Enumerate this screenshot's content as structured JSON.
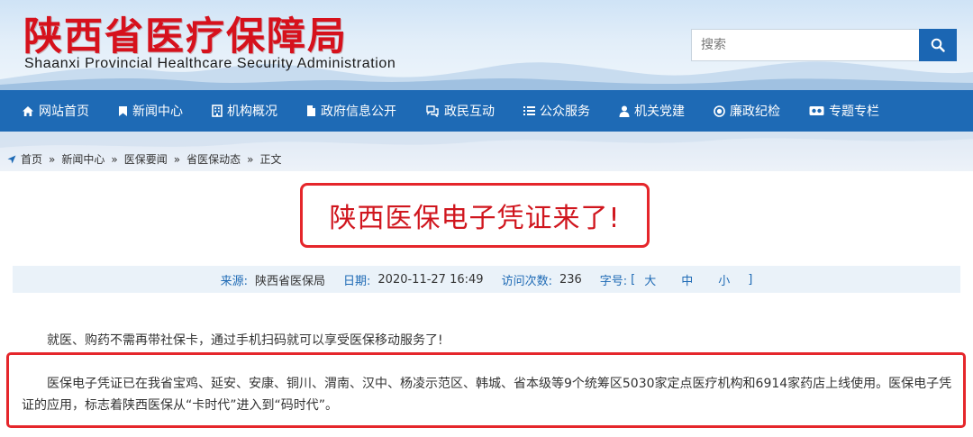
{
  "header": {
    "title_cn": "陕西省医疗保障局",
    "title_en": "Shaanxi Provincial Healthcare Security Administration",
    "search_placeholder": "搜索",
    "search_icon": "search-icon",
    "brand_red": "#d6111c",
    "brand_blue": "#1e6ab5"
  },
  "nav": {
    "items": [
      {
        "label": "网站首页",
        "icon": "home-icon"
      },
      {
        "label": "新闻中心",
        "icon": "bookmark-icon"
      },
      {
        "label": "机构概况",
        "icon": "building-icon"
      },
      {
        "label": "政府信息公开",
        "icon": "file-icon"
      },
      {
        "label": "政民互动",
        "icon": "chat-icon"
      },
      {
        "label": "公众服务",
        "icon": "list-icon"
      },
      {
        "label": "机关党建",
        "icon": "user-icon"
      },
      {
        "label": "廉政纪检",
        "icon": "circle-icon"
      },
      {
        "label": "专题专栏",
        "icon": "video-icon"
      }
    ]
  },
  "breadcrumb": {
    "icon": "location-arrow-icon",
    "items": [
      "首页",
      "新闻中心",
      "医保要闻",
      "省医保动态",
      "正文"
    ],
    "separator": "»"
  },
  "article": {
    "title": "陕西医保电子凭证来了!",
    "meta": {
      "source_label": "来源:",
      "source": "陕西省医保局",
      "date_label": "日期:",
      "date": "2020-11-27 16:49",
      "views_label": "访问次数:",
      "views": "236",
      "font_label": "字号:",
      "bracket_open": "[",
      "bracket_close": "]",
      "font_large": "大",
      "font_medium": "中",
      "font_small": "小"
    },
    "paragraph1": "就医、购药不需再带社保卡，通过手机扫码就可以享受医保移动服务了!",
    "paragraph2": "医保电子凭证已在我省宝鸡、延安、安康、铜川、渭南、汉中、杨凌示范区、韩城、省本级等9个统筹区5030家定点医疗机构和6914家药店上线使用。医保电子凭证的应用，标志着陕西医保从“卡时代”进入到“码时代”。",
    "highlight_color": "#e5262b"
  }
}
